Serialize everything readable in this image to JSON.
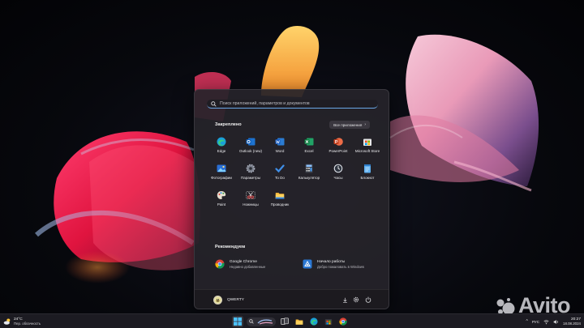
{
  "search": {
    "placeholder": "Поиск приложений, параметров и документов"
  },
  "pinned": {
    "title": "Закреплено",
    "all_apps_label": "Все приложения",
    "apps": [
      {
        "label": "Edge",
        "icon": "edge-icon"
      },
      {
        "label": "Outlook (new)",
        "icon": "outlook-icon"
      },
      {
        "label": "Word",
        "icon": "word-icon"
      },
      {
        "label": "Excel",
        "icon": "excel-icon"
      },
      {
        "label": "PowerPoint",
        "icon": "powerpoint-icon"
      },
      {
        "label": "Microsoft Store",
        "icon": "store-icon"
      },
      {
        "label": "Фотографии",
        "icon": "photos-icon"
      },
      {
        "label": "Параметры",
        "icon": "settings-icon"
      },
      {
        "label": "To Do",
        "icon": "todo-icon"
      },
      {
        "label": "Калькулятор",
        "icon": "calculator-icon"
      },
      {
        "label": "Часы",
        "icon": "clock-icon"
      },
      {
        "label": "Блокнот",
        "icon": "notepad-icon"
      },
      {
        "label": "Paint",
        "icon": "paint-icon"
      },
      {
        "label": "Ножницы",
        "icon": "snipping-tool-icon"
      },
      {
        "label": "Проводник",
        "icon": "file-explorer-icon"
      }
    ]
  },
  "recommended": {
    "title": "Рекомендуем",
    "items": [
      {
        "name": "Google Chrome",
        "subtitle": "Недавно добавленные",
        "icon": "chrome-icon"
      },
      {
        "name": "Начало работы",
        "subtitle": "Добро пожаловать в Windows",
        "icon": "get-started-icon"
      }
    ]
  },
  "user": {
    "name": "QWERTY"
  },
  "taskbar": {
    "weather": {
      "temperature": "24°C",
      "description": "Пер. облачность"
    },
    "language": "РУС",
    "time": "20:27",
    "date": "18.08.2024"
  },
  "watermark": {
    "text": "Avito"
  },
  "colors": {
    "accent": "#6aa7e6",
    "start_menu_bg": "#26232a",
    "taskbar_bg": "#1c1b22"
  }
}
